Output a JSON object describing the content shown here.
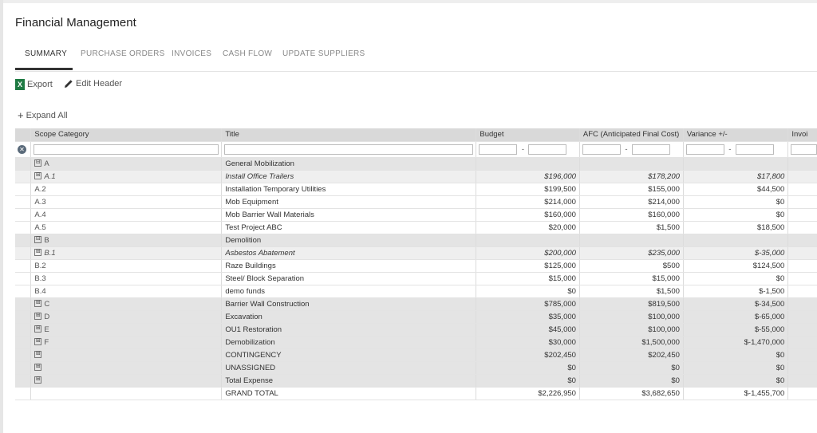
{
  "page": {
    "title": "Financial Management"
  },
  "tabs": [
    "SUMMARY",
    "PURCHASE ORDERS",
    "INVOICES",
    "CASH FLOW",
    "UPDATE SUPPLIERS"
  ],
  "actions": {
    "export": "Export",
    "edit_header": "Edit Header",
    "expand_all": "Expand All"
  },
  "grid": {
    "columns": [
      "Scope Category",
      "Title",
      "Budget",
      "AFC (Anticipated Final Cost)",
      "Variance +/-",
      "Invoi"
    ],
    "range_dash": "-",
    "rows": [
      {
        "type": "group",
        "toggle": "⊟",
        "code": "A",
        "title": "General Mobilization",
        "budget": "",
        "afc": "",
        "variance": ""
      },
      {
        "type": "sub",
        "toggle": "⊞",
        "code": "A.1",
        "title": "Install Office Trailers",
        "budget": "$196,000",
        "afc": "$178,200",
        "variance": "$17,800"
      },
      {
        "type": "item",
        "toggle": "",
        "code": "A.2",
        "title": "Installation Temporary Utilities",
        "budget": "$199,500",
        "afc": "$155,000",
        "variance": "$44,500"
      },
      {
        "type": "item",
        "toggle": "",
        "code": "A.3",
        "title": "Mob Equipment",
        "budget": "$214,000",
        "afc": "$214,000",
        "variance": "$0"
      },
      {
        "type": "item",
        "toggle": "",
        "code": "A.4",
        "title": "Mob Barrier Wall Materials",
        "budget": "$160,000",
        "afc": "$160,000",
        "variance": "$0"
      },
      {
        "type": "item",
        "toggle": "",
        "code": "A.5",
        "title": "Test Project ABC",
        "budget": "$20,000",
        "afc": "$1,500",
        "variance": "$18,500"
      },
      {
        "type": "group",
        "toggle": "⊟",
        "code": "B",
        "title": "Demolition",
        "budget": "",
        "afc": "",
        "variance": ""
      },
      {
        "type": "sub",
        "toggle": "⊞",
        "code": "B.1",
        "title": "Asbestos Abatement",
        "budget": "$200,000",
        "afc": "$235,000",
        "variance": "$-35,000"
      },
      {
        "type": "item",
        "toggle": "",
        "code": "B.2",
        "title": "Raze Buildings",
        "budget": "$125,000",
        "afc": "$500",
        "variance": "$124,500"
      },
      {
        "type": "item",
        "toggle": "",
        "code": "B.3",
        "title": "Steel/ Block Separation",
        "budget": "$15,000",
        "afc": "$15,000",
        "variance": "$0"
      },
      {
        "type": "item",
        "toggle": "",
        "code": "B.4",
        "title": "demo funds",
        "budget": "$0",
        "afc": "$1,500",
        "variance": "$-1,500"
      },
      {
        "type": "group",
        "toggle": "⊞",
        "code": "C",
        "title": "Barrier Wall Construction",
        "budget": "$785,000",
        "afc": "$819,500",
        "variance": "$-34,500"
      },
      {
        "type": "group",
        "toggle": "⊞",
        "code": "D",
        "title": "Excavation",
        "budget": "$35,000",
        "afc": "$100,000",
        "variance": "$-65,000"
      },
      {
        "type": "group",
        "toggle": "⊞",
        "code": "E",
        "title": "OU1 Restoration",
        "budget": "$45,000",
        "afc": "$100,000",
        "variance": "$-55,000"
      },
      {
        "type": "group",
        "toggle": "⊞",
        "code": "F",
        "title": "Demobilization",
        "budget": "$30,000",
        "afc": "$1,500,000",
        "variance": "$-1,470,000"
      },
      {
        "type": "group",
        "toggle": "⊞",
        "code": "",
        "title": "CONTINGENCY",
        "budget": "$202,450",
        "afc": "$202,450",
        "variance": "$0"
      },
      {
        "type": "group",
        "toggle": "⊞",
        "code": "",
        "title": "UNASSIGNED",
        "budget": "$0",
        "afc": "$0",
        "variance": "$0"
      },
      {
        "type": "group",
        "toggle": "⊞",
        "code": "",
        "title": "Total Expense",
        "budget": "$0",
        "afc": "$0",
        "variance": "$0"
      },
      {
        "type": "total",
        "toggle": "",
        "code": "",
        "title": "GRAND TOTAL",
        "budget": "$2,226,950",
        "afc": "$3,682,650",
        "variance": "$-1,455,700"
      }
    ]
  }
}
